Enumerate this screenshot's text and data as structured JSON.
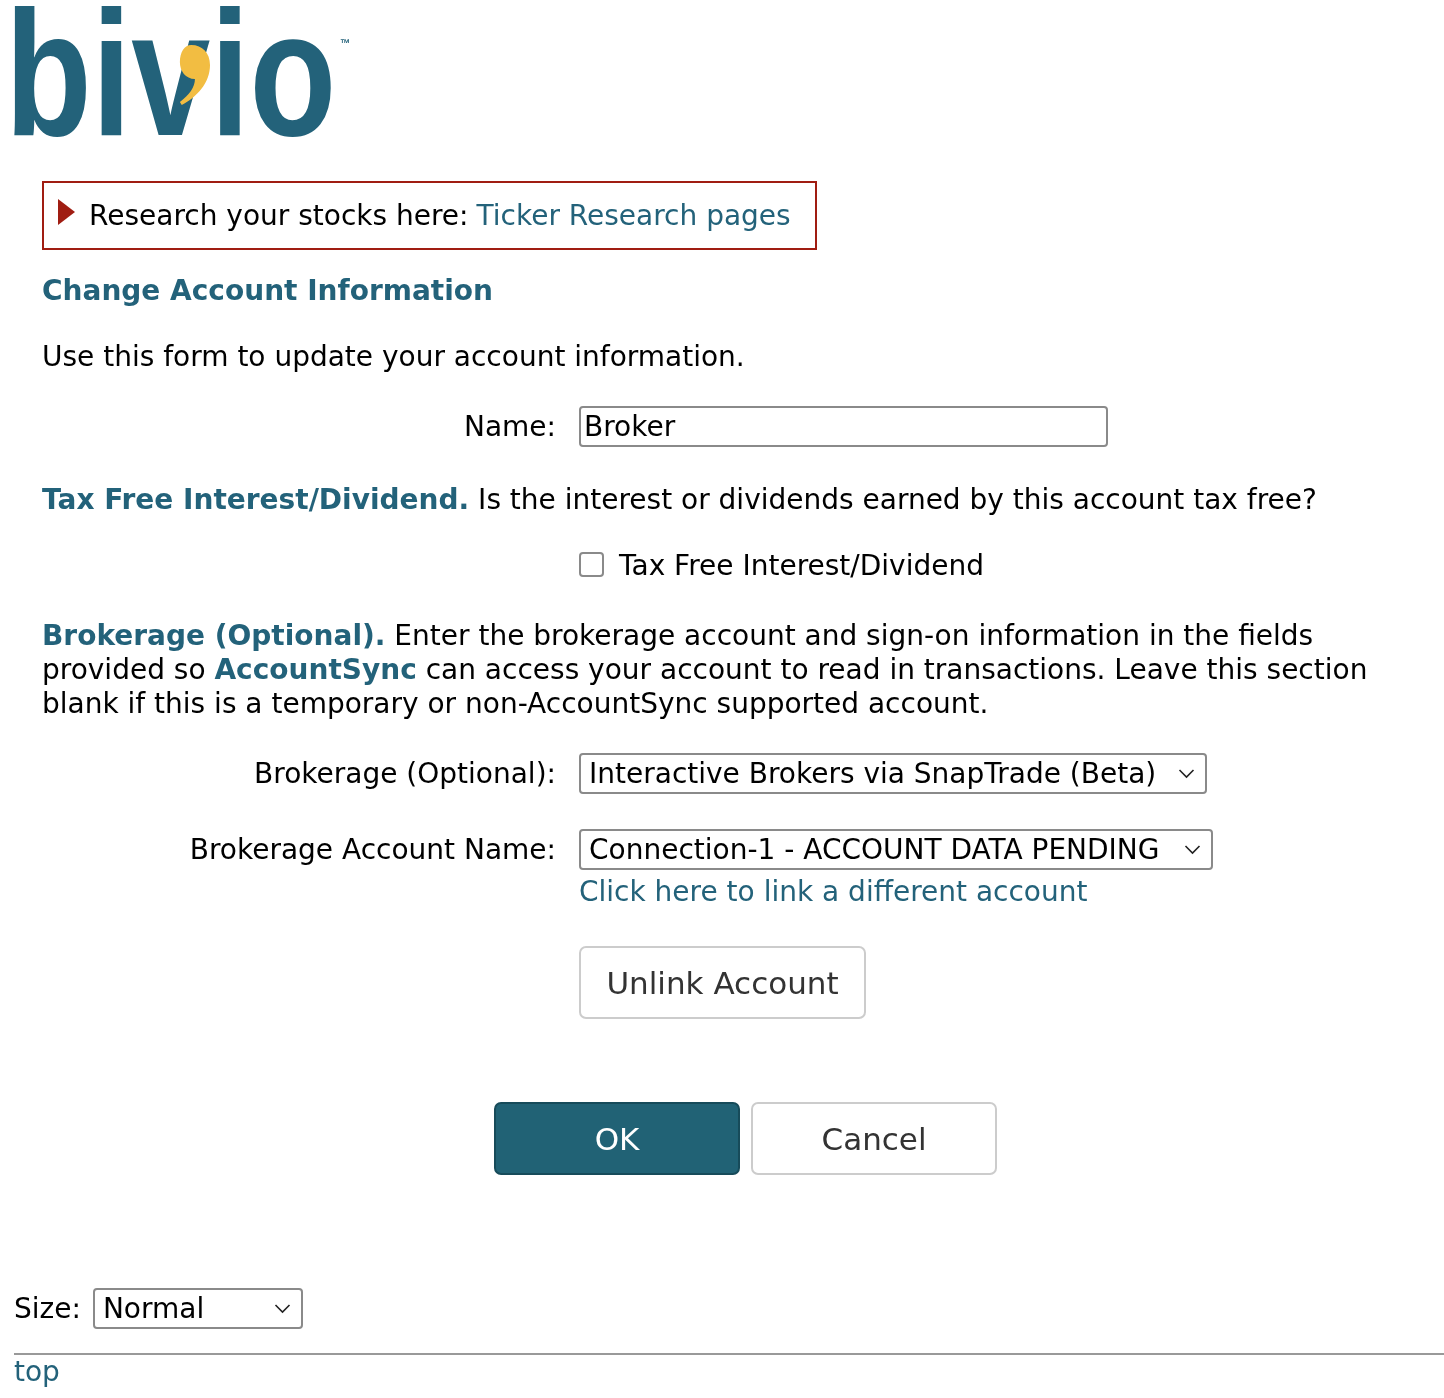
{
  "logo": {
    "text": "bivio",
    "trademark": "™"
  },
  "notice": {
    "text": "Research your stocks here:",
    "link": "Ticker Research pages"
  },
  "heading": "Change Account Information",
  "intro": "Use this form to update your account information.",
  "name_field": {
    "label": "Name:",
    "value": "Broker"
  },
  "tax_free": {
    "text": "**Tax Free Interest/Dividend.** Is the interest or dividends earned by this account tax free?",
    "checkbox": {
      "label": "Tax Free Interest/Dividend",
      "checked": false
    }
  },
  "brokerage_section": {
    "text": "**Brokerage (Optional).** Enter the brokerage account and sign-on information in the fields provided so **AccountSync** can access your account to read in transactions. Leave this section blank if this is a temporary or non-AccountSync supported account."
  },
  "brokerage_select": {
    "label": "Brokerage (Optional):",
    "value": "Interactive Brokers via SnapTrade (Beta)"
  },
  "account_select": {
    "label": "Brokerage Account Name:",
    "value": "Connection-1 - ACCOUNT DATA PENDING",
    "link": "Click here to link a different account"
  },
  "unlink_button": {
    "label": "Unlink Account"
  },
  "buttons": [
    {
      "label": "OK",
      "kind": "primary"
    },
    {
      "label": "Cancel",
      "kind": "secondary"
    }
  ],
  "size_select": {
    "label": "Size:",
    "value": "Normal"
  },
  "footer_link": "top"
}
